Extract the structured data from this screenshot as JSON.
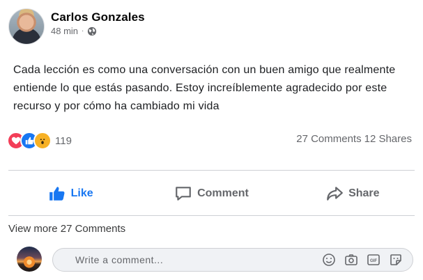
{
  "post": {
    "author": "Carlos Gonzales",
    "time": "48 min",
    "separator": "·",
    "visibility_icon": "globe-icon",
    "text": "Cada lección es como una conversación con un buen amigo que realmente entiende lo que estás pasando. Estoy increíblemente agradecido por este recurso y por cómo ha cambiado mi vida"
  },
  "reactions": {
    "icons": [
      "love-icon",
      "like-icon",
      "wow-icon"
    ],
    "count": "119",
    "comments": "27 Comments",
    "shares": "12 Shares"
  },
  "actions": {
    "like_label": "Like",
    "comment_label": "Comment",
    "share_label": "Share"
  },
  "comments": {
    "view_more": "View more 27 Comments",
    "placeholder": "Write a comment..."
  },
  "colors": {
    "accent": "#1877f2",
    "love": "#f33e58",
    "wow": "#f7b125",
    "muted": "#65676b"
  }
}
